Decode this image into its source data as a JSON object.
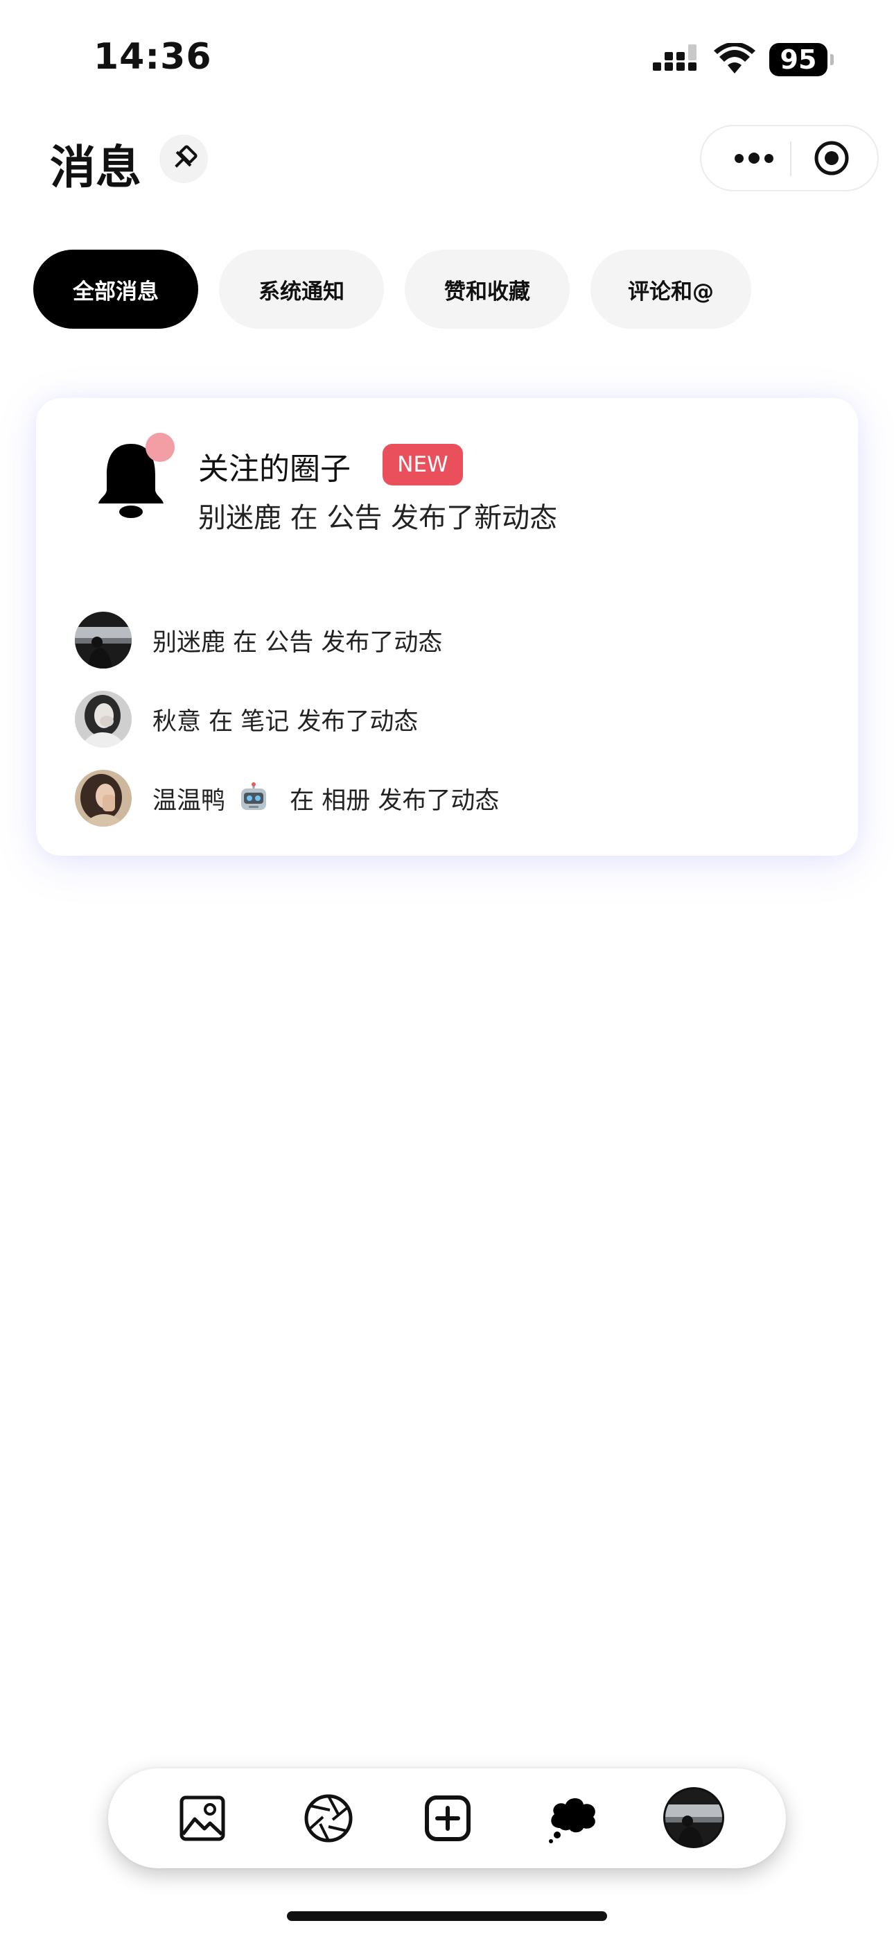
{
  "status_bar": {
    "time": "14:36",
    "battery": "95"
  },
  "header": {
    "title": "消息"
  },
  "tabs": [
    {
      "label": "全部消息",
      "active": true
    },
    {
      "label": "系统通知",
      "active": false
    },
    {
      "label": "赞和收藏",
      "active": false
    },
    {
      "label": "评论和@",
      "active": false
    }
  ],
  "card": {
    "title": "关注的圈子",
    "badge": "NEW",
    "subtitle": "别迷鹿 在 公告 发布了新动态",
    "items": [
      {
        "name": "别迷鹿",
        "text": " 在 公告 发布了动态"
      },
      {
        "name": "秋意",
        "text": " 在 笔记 发布了动态"
      },
      {
        "name": "温温鸭",
        "text": " 在 相册 发布了动态"
      }
    ]
  },
  "tabbar": {
    "icons": [
      "image-icon",
      "aperture-icon",
      "add-square-icon",
      "thought-bubble-icon",
      "profile-avatar"
    ]
  },
  "colors": {
    "accent": "#000000",
    "badge": "#e9505c",
    "dot": "#f29ea4",
    "tab_bg": "#f4f4f4"
  }
}
